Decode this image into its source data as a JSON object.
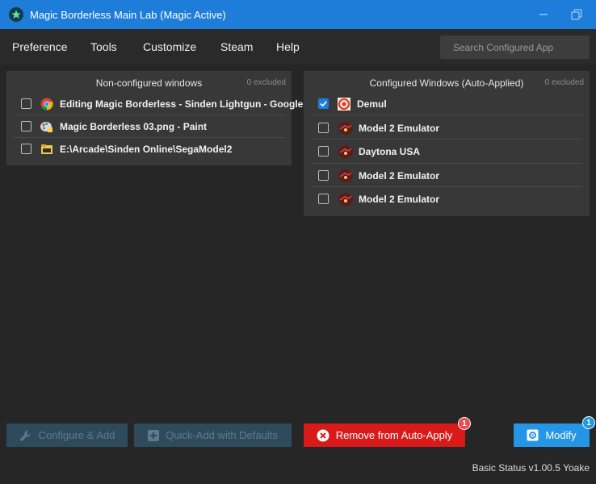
{
  "window": {
    "title": "Magic Borderless Main Lab (Magic Active)",
    "accent": "#1e7dd8"
  },
  "menu": {
    "items": [
      {
        "label": "Preference"
      },
      {
        "label": "Tools"
      },
      {
        "label": "Customize"
      },
      {
        "label": "Steam"
      },
      {
        "label": "Help"
      }
    ],
    "search_placeholder": "Search Configured App"
  },
  "left_panel": {
    "title": "Non-configured windows",
    "excluded": "0 excluded",
    "rows": [
      {
        "label": "Editing Magic Borderless - Sinden Lightgun - Google",
        "icon": "chrome-icon",
        "checked": false
      },
      {
        "label": "Magic Borderless 03.png - Paint",
        "icon": "paint-icon",
        "checked": false
      },
      {
        "label": "E:\\Arcade\\Sinden Online\\SegaModel2",
        "icon": "folder-icon",
        "checked": false
      }
    ]
  },
  "right_panel": {
    "title": "Configured Windows (Auto-Applied)",
    "excluded": "0 excluded",
    "rows": [
      {
        "label": "Demul",
        "icon": "demul-icon",
        "checked": true
      },
      {
        "label": "Model 2 Emulator",
        "icon": "model2-icon",
        "checked": false
      },
      {
        "label": "Daytona USA",
        "icon": "model2-icon",
        "checked": false
      },
      {
        "label": "Model 2 Emulator",
        "icon": "model2-icon",
        "checked": false
      },
      {
        "label": "Model 2 Emulator",
        "icon": "model2-icon",
        "checked": false
      }
    ]
  },
  "actions": {
    "configure_add": "Configure & Add",
    "quick_add": "Quick-Add with Defaults",
    "remove": "Remove from Auto-Apply",
    "remove_badge": "1",
    "modify": "Modify",
    "modify_badge": "1"
  },
  "status": {
    "text": "Basic Status v1.00.5 Yoake"
  }
}
